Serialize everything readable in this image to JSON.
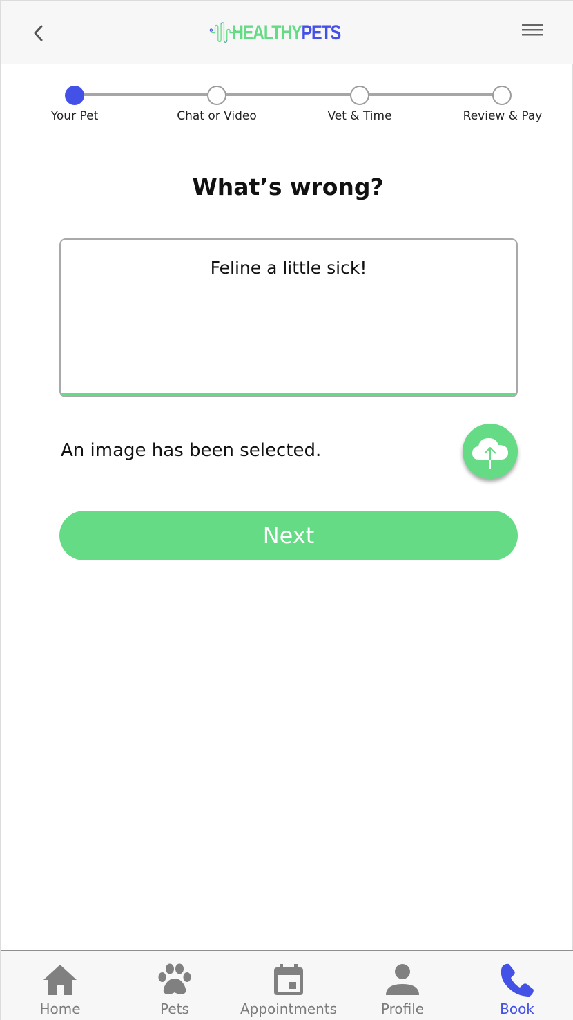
{
  "app": {
    "logo_text_1": "HEALTHY",
    "logo_text_2": "PETS"
  },
  "colors": {
    "accent_green": "#66db86",
    "accent_blue": "#4451e6",
    "inactive_gray": "#7c7c7c"
  },
  "header": {
    "back_icon": "chevron-left-icon",
    "menu_icon": "hamburger-menu-icon"
  },
  "stepper": {
    "steps": [
      {
        "label": "Your Pet",
        "state": "active"
      },
      {
        "label": "Chat or Video",
        "state": "inactive"
      },
      {
        "label": "Vet & Time",
        "state": "inactive"
      },
      {
        "label": "Review & Pay",
        "state": "inactive"
      }
    ]
  },
  "main": {
    "title": "What’s wrong?",
    "description_value": "Feline a little sick!",
    "image_status": "An image has been selected.",
    "upload_icon": "cloud-upload-icon",
    "next_label": "Next"
  },
  "bottom_nav": {
    "items": [
      {
        "label": "Home",
        "icon": "home-icon",
        "active": false
      },
      {
        "label": "Pets",
        "icon": "paw-icon",
        "active": false
      },
      {
        "label": "Appointments",
        "icon": "calendar-icon",
        "active": false
      },
      {
        "label": "Profile",
        "icon": "person-icon",
        "active": false
      },
      {
        "label": "Book",
        "icon": "phone-icon",
        "active": true
      }
    ]
  }
}
